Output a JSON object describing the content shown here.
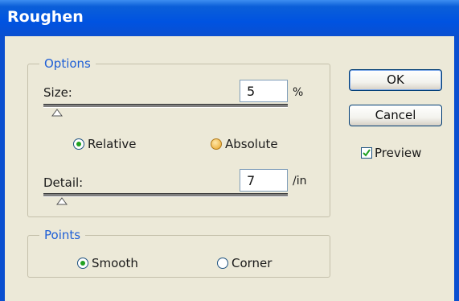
{
  "window": {
    "title": "Roughen"
  },
  "options": {
    "legend": "Options",
    "size": {
      "label": "Size:",
      "value": "5",
      "unit": "%"
    },
    "relative_label": "Relative",
    "absolute_label": "Absolute",
    "detail": {
      "label": "Detail:",
      "value": "7",
      "unit": "/in"
    }
  },
  "points": {
    "legend": "Points",
    "smooth_label": "Smooth",
    "corner_label": "Corner"
  },
  "buttons": {
    "ok": "OK",
    "cancel": "Cancel"
  },
  "preview": {
    "label": "Preview",
    "checked": true
  },
  "colors": {
    "title_bar": "#0053e1",
    "legend_text": "#1e5fd6",
    "dialog_bg": "#ece9d8"
  }
}
